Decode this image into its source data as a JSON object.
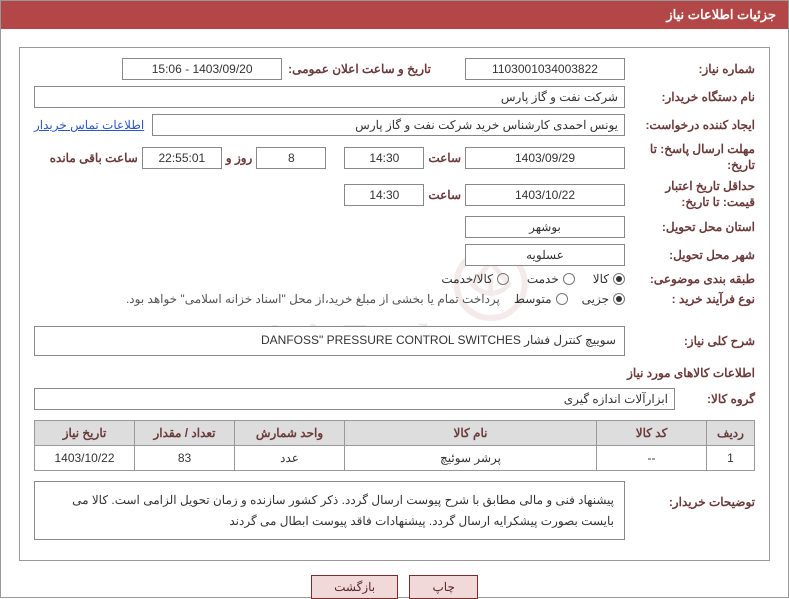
{
  "header_title": "جزئیات اطلاعات نیاز",
  "need_number_label": "شماره نیاز:",
  "need_number": "1103001034003822",
  "announce_label": "تاریخ و ساعت اعلان عمومی:",
  "announce_value": "1403/09/20 - 15:06",
  "buyer_org_label": "نام دستگاه خریدار:",
  "buyer_org": "شرکت نفت و گاز پارس",
  "requestor_label": "ایجاد کننده درخواست:",
  "requestor": "یونس احمدی کارشناس خرید شرکت نفت و گاز پارس",
  "contact_link": "اطلاعات تماس خریدار",
  "deadline_label": "مهلت ارسال پاسخ: تا تاریخ:",
  "deadline_date": "1403/09/29",
  "hour_label": "ساعت",
  "deadline_time": "14:30",
  "days_remaining": "8",
  "days_suffix": "روز و",
  "clock_remaining": "22:55:01",
  "remaining_suffix": "ساعت باقی مانده",
  "min_validity_label": "حداقل تاریخ اعتبار قیمت: تا تاریخ:",
  "min_validity_date": "1403/10/22",
  "min_validity_time": "14:30",
  "delivery_province_label": "استان محل تحویل:",
  "delivery_province": "بوشهر",
  "delivery_city_label": "شهر محل تحویل:",
  "delivery_city": "عسلویه",
  "category_label": "طبقه بندی موضوعی:",
  "cat_goods": "کالا",
  "cat_service": "خدمت",
  "cat_goods_service": "کالا/خدمت",
  "process_label": "نوع فرآیند خرید :",
  "proc_partial": "جزیی",
  "proc_medium": "متوسط",
  "payment_note": "پرداخت تمام یا بخشی از مبلغ خرید،از محل \"اسناد خزانه اسلامی\" خواهد بود.",
  "total_desc_label": "شرح کلی نیاز:",
  "total_desc": "DANFOSS\" PRESSURE CONTROL SWITCHES سوییچ کنترل فشار",
  "goods_section_title": "اطلاعات کالاهای مورد نیاز",
  "goods_group_label": "گروه کالا:",
  "goods_group": "ابزارآلات اندازه گیری",
  "table": {
    "headers": {
      "row": "ردیف",
      "code": "کد کالا",
      "name": "نام کالا",
      "unit": "واحد شمارش",
      "qty": "تعداد / مقدار",
      "date": "تاریخ نیاز"
    },
    "rows": [
      {
        "row": "1",
        "code": "--",
        "name": "پرشر سوئیچ",
        "unit": "عدد",
        "qty": "83",
        "date": "1403/10/22"
      }
    ]
  },
  "buyer_notes_label": "توضیحات خریدار:",
  "buyer_notes": "پیشنهاد فنی و مالی مطابق با شرح پیوست ارسال گردد. ذکر کشور سازنده و زمان تحویل الزامی است. کالا می بایست بصورت پیشکرایه ارسال گردد. پیشنهادات فاقد پیوست ابطال می گردند",
  "btn_print": "چاپ",
  "btn_back": "بازگشت",
  "watermark_text": "AriaTender.net"
}
